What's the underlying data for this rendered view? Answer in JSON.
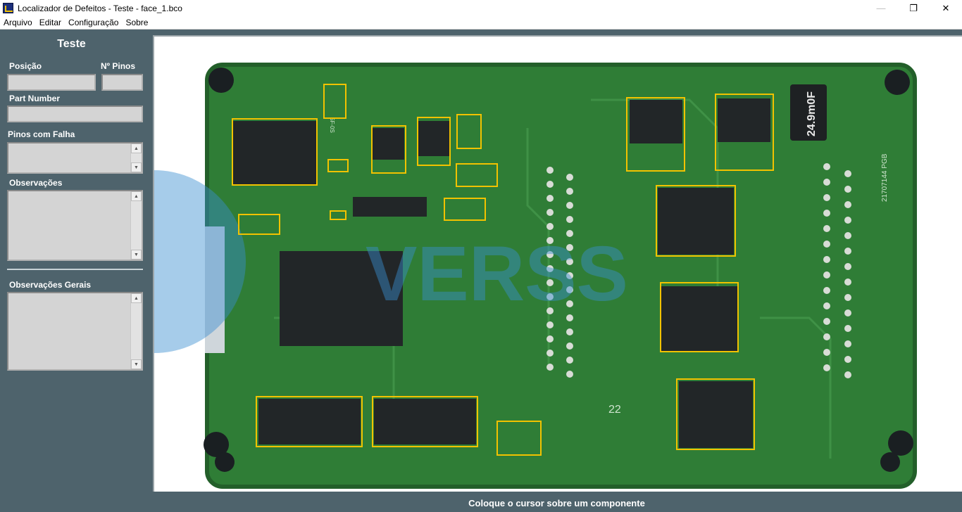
{
  "window": {
    "title": "Localizador de Defeitos - Teste - face_1.bco",
    "icons": {
      "minimize": "minimize-icon",
      "maximize": "maximize-icon",
      "close": "close-icon"
    }
  },
  "menu": {
    "items": [
      "Arquivo",
      "Editar",
      "Configuração",
      "Sobre"
    ]
  },
  "panel": {
    "title": "Teste",
    "position_label": "Posição",
    "position_value": "",
    "pins_label": "Nº Pinos",
    "pins_value": "",
    "part_number_label": "Part Number",
    "part_number_value": "",
    "failed_pins_label": "Pinos com Falha",
    "failed_pins_value": "",
    "observations_label": "Observações",
    "observations_value": "",
    "general_observations_label": "Observações Gerais",
    "general_observations_value": ""
  },
  "board": {
    "marking_coil": "24.9m0F",
    "marking_silk_22": "22",
    "marking_side": "21707144 PGB",
    "marking_left": "5F-0S",
    "watermark": "VERSS",
    "colors": {
      "pcb": "#2f7d36",
      "pcb_dark": "#235f2a",
      "highlight": "#f2c200",
      "chip": "#222628",
      "watermark": "#3a8fd0"
    }
  },
  "status": {
    "message": "Coloque o cursor sobre um componente"
  }
}
